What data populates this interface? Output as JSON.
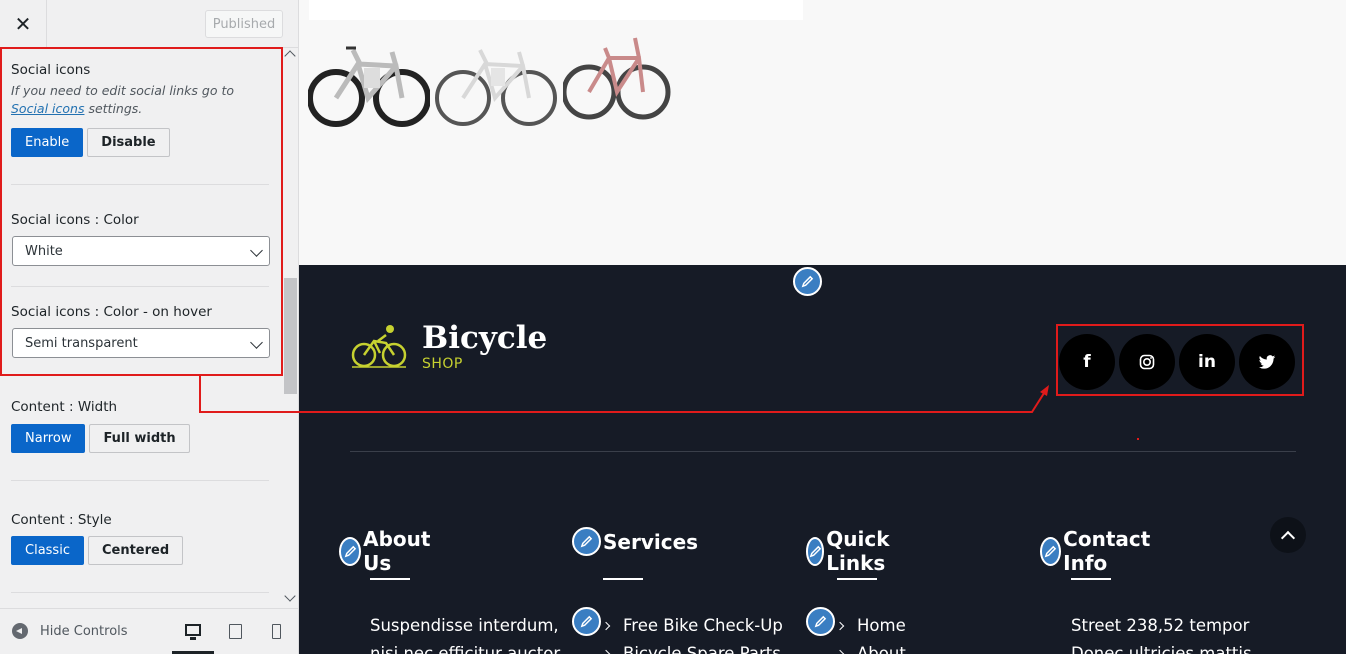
{
  "topbar": {
    "close_glyph": "✕",
    "published_label": "Published"
  },
  "controls": {
    "social_icons": {
      "title": "Social icons",
      "desc_prefix": "If you need to edit social links go to ",
      "desc_link": "Social icons",
      "desc_suffix": " settings.",
      "enable_label": "Enable",
      "disable_label": "Disable",
      "selected": "Enable"
    },
    "social_color": {
      "title": "Social icons : Color",
      "value": "White"
    },
    "social_hover": {
      "title": "Social icons : Color - on hover",
      "value": "Semi transparent"
    },
    "content_width": {
      "title": "Content : Width",
      "options": [
        "Narrow",
        "Full width"
      ],
      "selected": "Narrow"
    },
    "content_style": {
      "title": "Content : Style",
      "options": [
        "Classic",
        "Centered"
      ],
      "selected": "Classic"
    }
  },
  "bottombar": {
    "hide_label": "Hide Controls",
    "devices": [
      "desktop-icon",
      "tablet-icon",
      "mobile-icon"
    ],
    "active_device": "desktop"
  },
  "site": {
    "logo_title": "Bicycle",
    "logo_sub": "SHOP",
    "social": [
      {
        "icon": "facebook-icon",
        "glyph": "f"
      },
      {
        "icon": "instagram-icon",
        "glyph": "◎"
      },
      {
        "icon": "linkedin-icon",
        "glyph": "in"
      },
      {
        "icon": "twitter-icon",
        "glyph": "🐦"
      }
    ],
    "columns": {
      "about": {
        "title": "About Us",
        "text1": "Suspendisse interdum,",
        "text2": "nisi nec efficitur auctor"
      },
      "services": {
        "title": "Services",
        "item1": "Free Bike Check-Up",
        "item2": "Bicycle Spare Parts"
      },
      "quick": {
        "title": "Quick Links",
        "item1": "Home",
        "item2": "About"
      },
      "contact": {
        "title": "Contact Info",
        "text1": "Street 238,52 tempor",
        "text2": "Donec ultricies mattis"
      }
    }
  },
  "colors": {
    "active_button": "#0a66c9",
    "footer_bg": "#161b26",
    "logo_accent": "#c6d130",
    "annotation": "#e01b1b",
    "edit_pencil": "#3a7ec2"
  }
}
